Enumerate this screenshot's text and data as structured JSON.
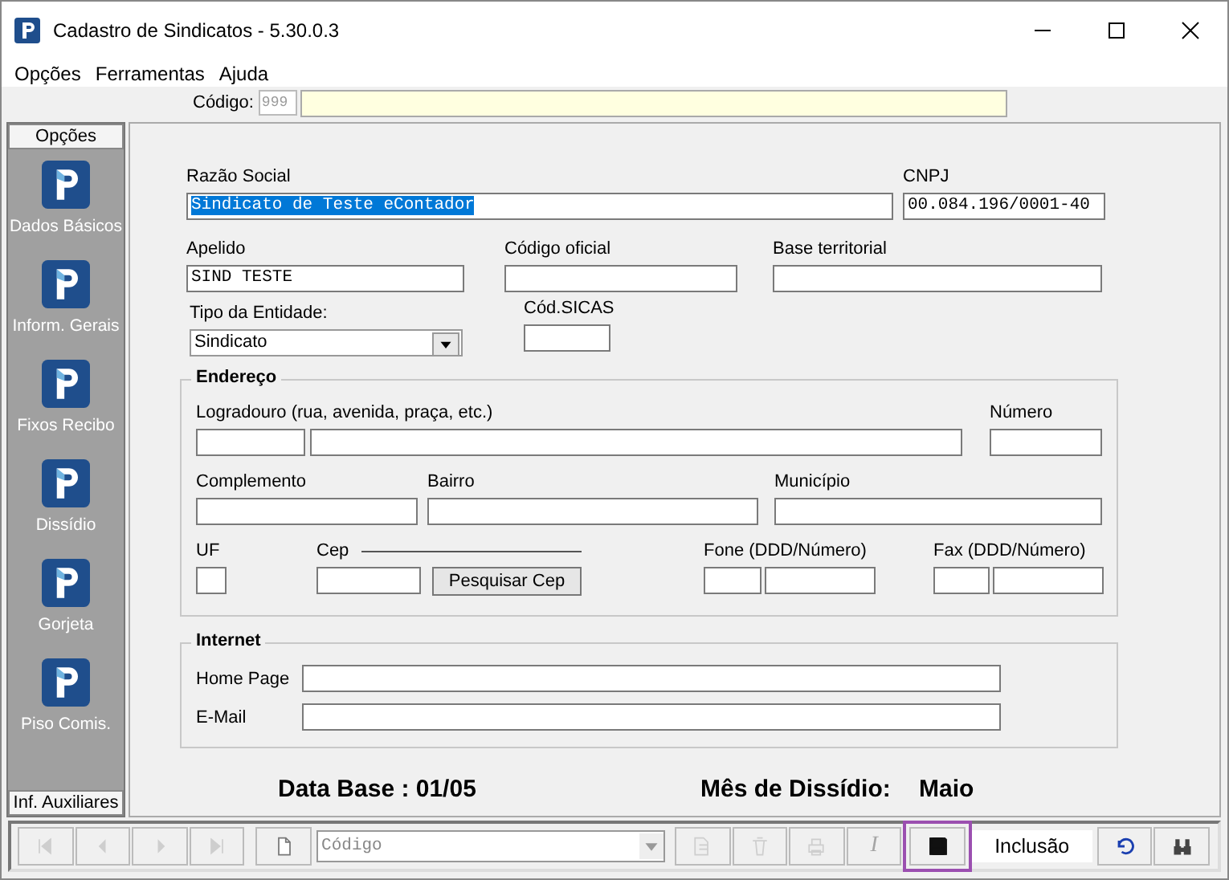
{
  "window": {
    "title": "Cadastro de Sindicatos - 5.30.0.3"
  },
  "menu": [
    "Opções",
    "Ferramentas",
    "Ajuda"
  ],
  "code_bar": {
    "label": "Código:",
    "code": "999"
  },
  "sidebar": {
    "header": "Opções",
    "items": [
      {
        "label": "Dados Básicos"
      },
      {
        "label": "Inform. Gerais"
      },
      {
        "label": "Fixos Recibo"
      },
      {
        "label": "Dissídio"
      },
      {
        "label": "Gorjeta"
      },
      {
        "label": "Piso Comis."
      }
    ],
    "footer": "Inf. Auxiliares"
  },
  "form": {
    "razao_social": {
      "label": "Razão Social",
      "value": "Sindicato de Teste eContador",
      "selected": true
    },
    "cnpj": {
      "label": "CNPJ",
      "value": "00.084.196/0001-40"
    },
    "apelido": {
      "label": "Apelido",
      "value": "SIND TESTE"
    },
    "codigo_oficial": {
      "label": "Código oficial"
    },
    "base_territorial": {
      "label": "Base territorial"
    },
    "tipo_entidade": {
      "label": "Tipo da Entidade:",
      "value": "Sindicato"
    },
    "cod_sicas": {
      "label": "Cód.SICAS"
    },
    "endereco": {
      "title": "Endereço",
      "logradouro": "Logradouro (rua, avenida, praça, etc.)",
      "numero": "Número",
      "complemento": "Complemento",
      "bairro": "Bairro",
      "municipio": "Município",
      "uf": "UF",
      "cep": "Cep",
      "search_button": "Pesquisar Cep",
      "fone": "Fone (DDD/Número)",
      "fax": "Fax (DDD/Número)"
    },
    "internet": {
      "title": "Internet",
      "home_page": "Home Page",
      "email": "E-Mail"
    },
    "data_base": {
      "label": "Data Base :",
      "value": "01/05"
    },
    "mes_dissidio": {
      "label": "Mês de Dissídio:",
      "value": "Maio"
    }
  },
  "toolbar": [
    {
      "kind": "first",
      "disabled": true
    },
    {
      "kind": "prev",
      "disabled": true
    },
    {
      "kind": "next",
      "disabled": true
    },
    {
      "kind": "last",
      "disabled": true
    },
    {
      "kind": "new",
      "disabled": false
    },
    {
      "kind": "combo",
      "placeholder": "Código"
    },
    {
      "kind": "edit",
      "disabled": true
    },
    {
      "kind": "delete",
      "disabled": true
    },
    {
      "kind": "print",
      "disabled": true
    },
    {
      "kind": "italic",
      "text": "I",
      "disabled": true
    },
    {
      "kind": "save",
      "disabled": false,
      "highlighted": true
    },
    {
      "kind": "status",
      "text": "Inclusão"
    },
    {
      "kind": "undo",
      "disabled": false
    },
    {
      "kind": "find",
      "disabled": false
    }
  ]
}
